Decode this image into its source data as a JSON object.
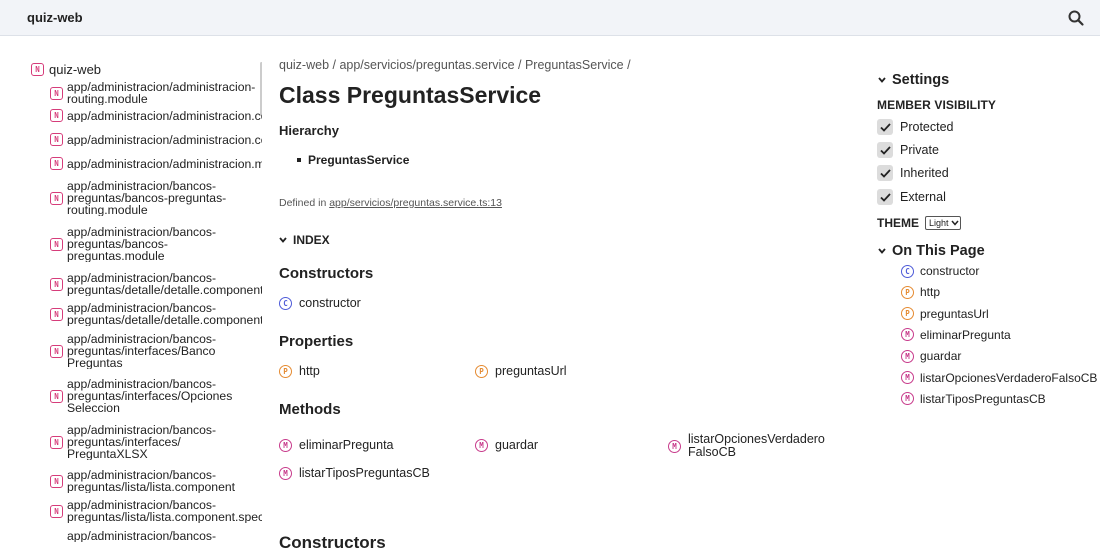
{
  "header": {
    "brand": "quiz-web"
  },
  "sidebar": {
    "root": {
      "icon": "namespace-icon",
      "badge": "N",
      "label": "quiz-web"
    },
    "items": [
      {
        "badge": "N",
        "lines": [
          "app/administracion/administracion-",
          "routing.module"
        ]
      },
      {
        "badge": "N",
        "lines": [
          "app/administracion/administracion.cc"
        ]
      },
      {
        "badge": "N",
        "lines": [
          "app/administracion/administracion.cc"
        ]
      },
      {
        "badge": "N",
        "lines": [
          "app/administracion/administracion.m"
        ]
      },
      {
        "badge": "N",
        "lines": [
          "app/administracion/bancos-",
          "preguntas/bancos-preguntas-",
          "routing.module"
        ]
      },
      {
        "badge": "N",
        "lines": [
          "app/administracion/bancos-",
          "preguntas/bancos-",
          "preguntas.module"
        ]
      },
      {
        "badge": "N",
        "lines": [
          "app/administracion/bancos-",
          "preguntas/detalle/detalle.component"
        ]
      },
      {
        "badge": "N",
        "lines": [
          "app/administracion/bancos-",
          "preguntas/detalle/detalle.component"
        ]
      },
      {
        "badge": "N",
        "lines": [
          "app/administracion/bancos-",
          "preguntas/interfaces/Banco",
          "Preguntas"
        ]
      },
      {
        "badge": "N",
        "lines": [
          "app/administracion/bancos-",
          "preguntas/interfaces/Opciones",
          "Seleccion"
        ]
      },
      {
        "badge": "N",
        "lines": [
          "app/administracion/bancos-",
          "preguntas/interfaces/",
          "PreguntaXLSX"
        ]
      },
      {
        "badge": "N",
        "lines": [
          "app/administracion/bancos-",
          "preguntas/lista/lista.component"
        ]
      },
      {
        "badge": "N",
        "lines": [
          "app/administracion/bancos-",
          "preguntas/lista/lista.component.spec"
        ]
      },
      {
        "badge": "N",
        "lines": [
          "app/administracion/bancos-"
        ]
      }
    ]
  },
  "main": {
    "breadcrumb": "quiz-web / app/servicios/preguntas.service / PreguntasService /",
    "title": "Class PreguntasService",
    "hierarchy_title": "Hierarchy",
    "hierarchy_item": "PreguntasService",
    "defined_in_prefix": "Defined in",
    "defined_in_link": "app/servicios/preguntas.service.ts:13",
    "index_label": "INDEX",
    "constructors_title": "Constructors",
    "constructors": [
      {
        "badge": "C",
        "label": "constructor"
      }
    ],
    "properties_title": "Properties",
    "properties": [
      {
        "badge": "P",
        "label": "http"
      },
      {
        "badge": "P",
        "label": "preguntasUrl"
      }
    ],
    "methods_title": "Methods",
    "methods": [
      {
        "badge": "M",
        "label": "eliminarPregunta"
      },
      {
        "badge": "M",
        "label": "guardar"
      },
      {
        "badge": "M",
        "label": "listarOpcionesVerdaderoFalsoCB",
        "line1": "listarOpcionesVerdadero",
        "line2": "FalsoCB"
      },
      {
        "badge": "M",
        "label": "listarTiposPreguntasCB"
      }
    ],
    "constructors_bottom_title": "Constructors"
  },
  "settings": {
    "title": "Settings",
    "visibility_title": "MEMBER VISIBILITY",
    "options": [
      {
        "label": "Protected",
        "checked": true
      },
      {
        "label": "Private",
        "checked": true
      },
      {
        "label": "Inherited",
        "checked": true
      },
      {
        "label": "External",
        "checked": true
      }
    ],
    "theme_label": "THEME",
    "theme_value": "Light"
  },
  "on_this_page": {
    "title": "On This Page",
    "items": [
      {
        "badge": "C",
        "label": "constructor"
      },
      {
        "badge": "P",
        "label": "http"
      },
      {
        "badge": "P",
        "label": "preguntasUrl"
      },
      {
        "badge": "M",
        "label": "eliminarPregunta"
      },
      {
        "badge": "M",
        "label": "guardar"
      },
      {
        "badge": "M",
        "label": "listarOpcionesVerdaderoFalsoCB"
      },
      {
        "badge": "M",
        "label": "listarTiposPreguntasCB"
      }
    ]
  },
  "colors": {
    "topbar_bg": "#f2f4f8",
    "namespace": "#d63c7a",
    "constructor": "#4e5bd8",
    "property": "#e58b32",
    "method": "#c83c8c"
  }
}
